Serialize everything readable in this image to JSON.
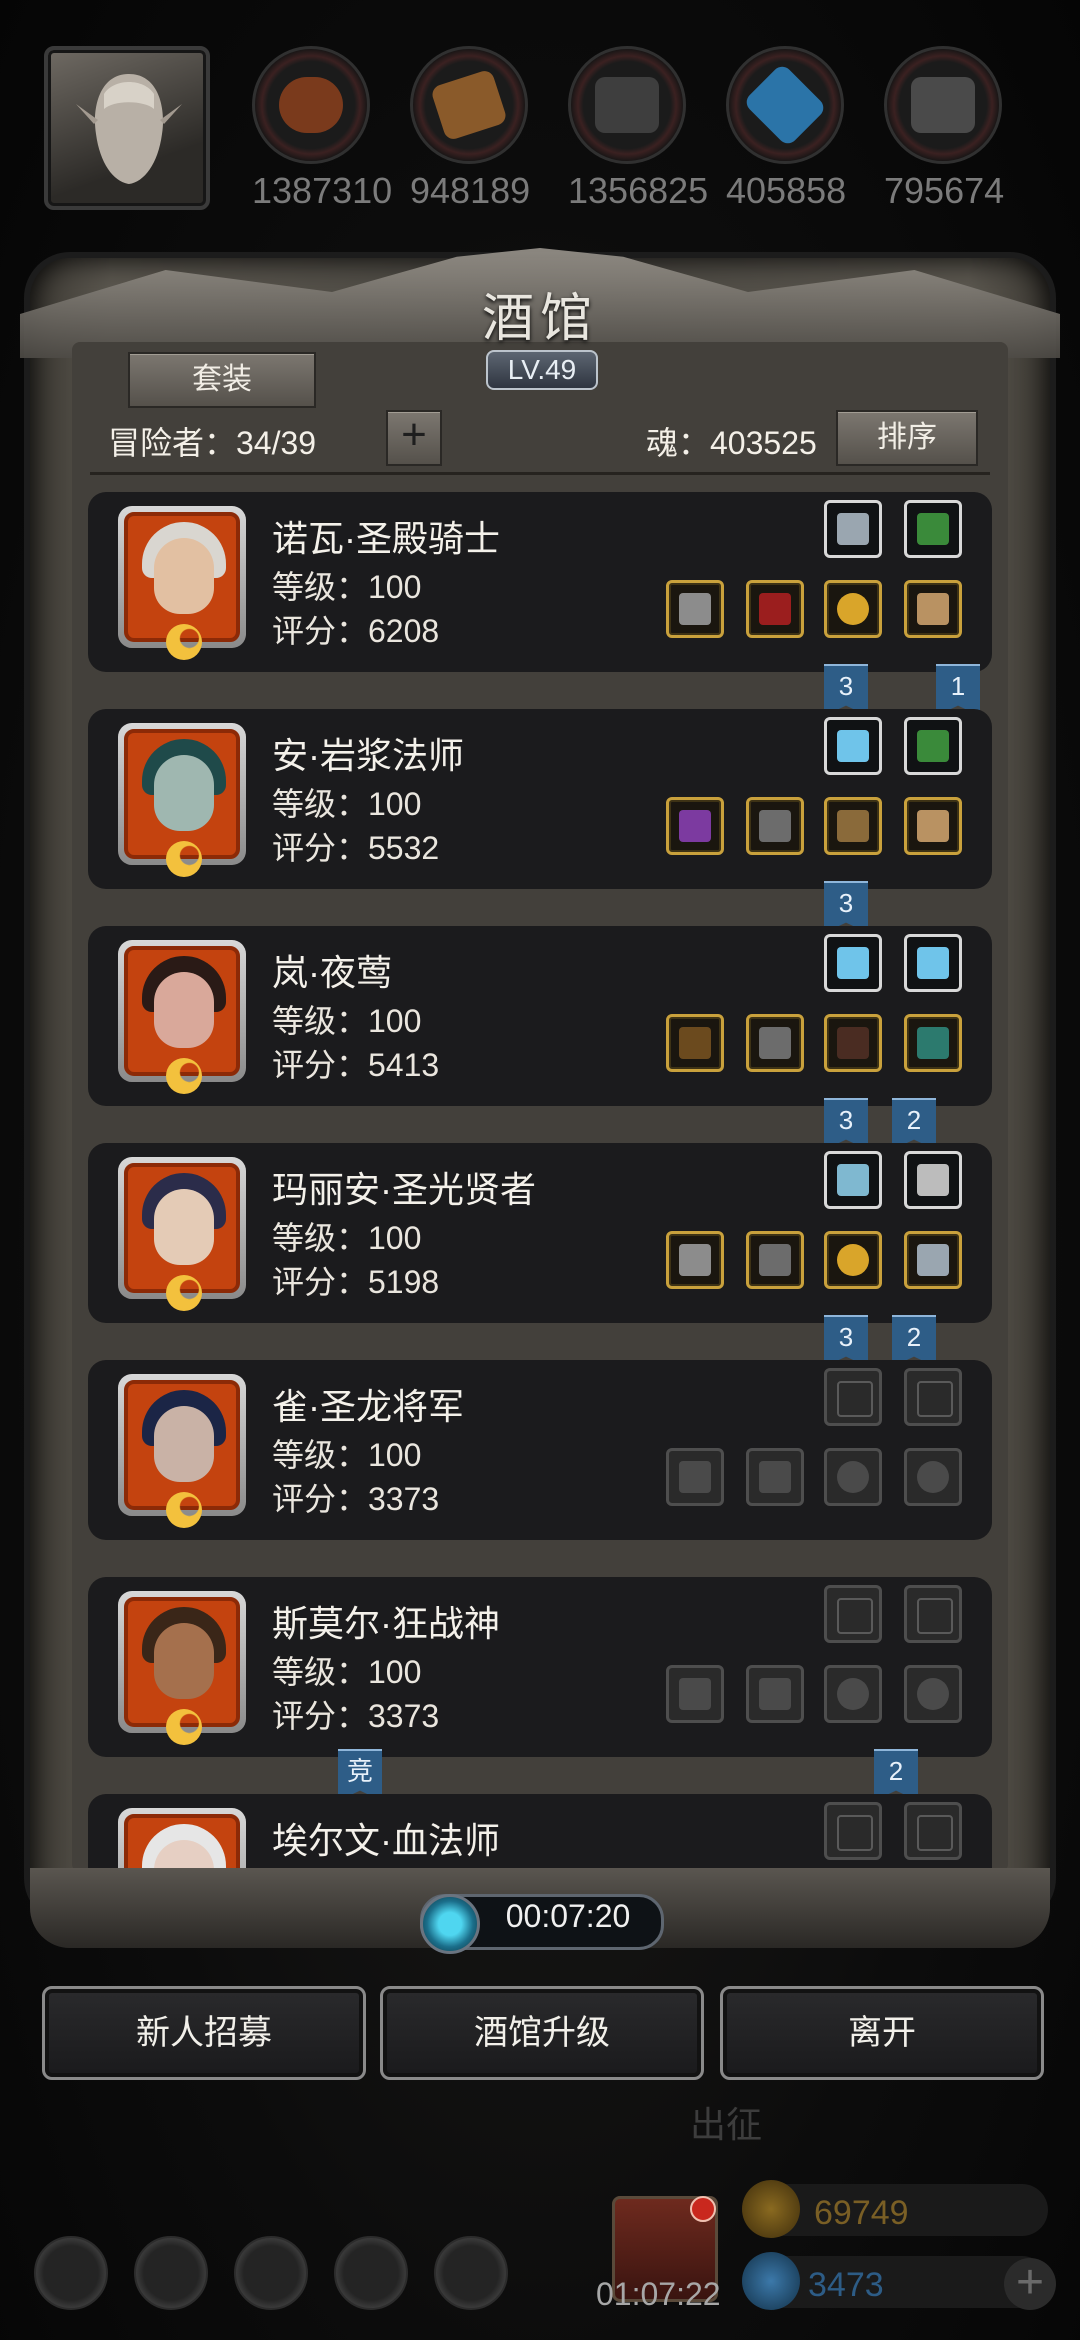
{
  "resources": [
    {
      "name": "meat",
      "value": "1387310",
      "color": "#7a3a1c"
    },
    {
      "name": "wood",
      "value": "948189",
      "color": "#8a5a2a"
    },
    {
      "name": "iron",
      "value": "1356825",
      "color": "#3e3e3e"
    },
    {
      "name": "crystal",
      "value": "405858",
      "color": "#2b74a8"
    },
    {
      "name": "stone",
      "value": "795674",
      "color": "#4a4a4a"
    }
  ],
  "tavern": {
    "title": "酒馆",
    "level": "LV.49",
    "suit_label": "套装",
    "adventurers_label": "冒险者：34/39",
    "add_label": "+",
    "soul_label": "魂：403525",
    "sort_label": "排序"
  },
  "heroes": [
    {
      "name": "诺瓦·圣殿骑士",
      "level": "等级：100",
      "score": "评分：6208",
      "hair": "#d9d6d0",
      "skin": "#e2c0a2",
      "top_slots": [
        "grey-book",
        "grey-scroll"
      ],
      "bottom_slots": [
        "gold-hammer",
        "gold-robe",
        "gold-ring",
        "gold-boots"
      ],
      "ribbons": [
        "3",
        "1"
      ]
    },
    {
      "name": "安·岩浆法师",
      "level": "等级：100",
      "score": "评分：5532",
      "hair": "#1f4a4a",
      "skin": "#9fb7b0",
      "top_slots": [
        "grey-crystal",
        "grey-scroll"
      ],
      "bottom_slots": [
        "gold-staff",
        "gold-armor",
        "gold-necklace",
        "gold-boots"
      ],
      "ribbons": [
        "3"
      ]
    },
    {
      "name": "岚·夜莺",
      "level": "等级：100",
      "score": "评分：5413",
      "hair": "#2a1a16",
      "skin": "#d9a89a",
      "top_slots": [
        "grey-crystal",
        "grey-crystal"
      ],
      "bottom_slots": [
        "gold-bow",
        "gold-armor",
        "gold-cloak",
        "gold-bracer"
      ],
      "ribbons": [
        "3",
        "2"
      ]
    },
    {
      "name": "玛丽安·圣光贤者",
      "level": "等级：100",
      "score": "评分：5198",
      "hair": "#2b2c4a",
      "skin": "#e4cbb6",
      "top_slots": [
        "grey-amulet",
        "grey-emblem"
      ],
      "bottom_slots": [
        "gold-hammer",
        "gold-armor",
        "gold-ring",
        "gold-book"
      ],
      "ribbons": [
        "3",
        "2"
      ]
    },
    {
      "name": "雀·圣龙将军",
      "level": "等级：100",
      "score": "评分：3373",
      "hair": "#1b2546",
      "skin": "#c9b2a6",
      "top_slots": [
        "empty",
        "empty"
      ],
      "bottom_slots": [
        "empty-sword",
        "empty-armor",
        "empty-ring",
        "empty-ring"
      ],
      "ribbons": []
    },
    {
      "name": "斯莫尔·狂战神",
      "level": "等级：100",
      "score": "评分：3373",
      "hair": "#3a2618",
      "skin": "#a5704d",
      "top_slots": [
        "empty",
        "empty"
      ],
      "bottom_slots": [
        "empty-axe",
        "empty-armor",
        "empty-ring",
        "empty-ring"
      ],
      "ribbons": [
        "竞",
        "2"
      ]
    },
    {
      "name": "埃尔文·血法师",
      "level": "",
      "score": "",
      "hair": "#e6e6e6",
      "skin": "#e6cfc3",
      "top_slots": [
        "empty",
        "empty"
      ],
      "bottom_slots": [],
      "ribbons": []
    }
  ],
  "timer": "00:07:20",
  "buttons": {
    "recruit": "新人招募",
    "upgrade": "酒馆升级",
    "leave": "离开"
  },
  "background": {
    "expedition": "出征",
    "chest_timer": "01:07:22",
    "gold": "69749",
    "gems": "3473",
    "add": "+"
  }
}
